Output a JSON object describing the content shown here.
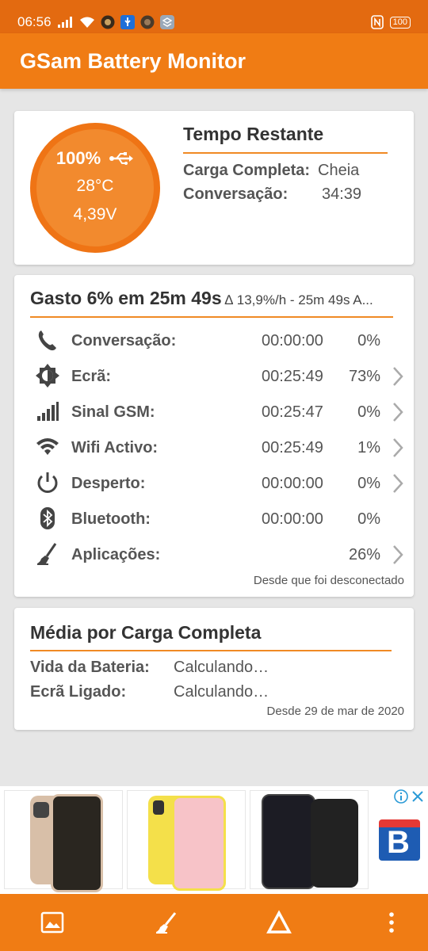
{
  "status_bar": {
    "time": "06:56",
    "battery": "100",
    "icons": [
      "signal-icon",
      "wifi-icon",
      "notification-icon",
      "usb-icon",
      "notification-icon",
      "stack-icon",
      "nfc-icon",
      "battery-icon"
    ]
  },
  "app": {
    "title": "GSam Battery Monitor"
  },
  "gauge": {
    "percent": "100%",
    "temperature": "28°C",
    "voltage": "4,39V",
    "charging_icon": "usb-icon"
  },
  "remaining": {
    "title": "Tempo Restante",
    "rows": [
      {
        "label": "Carga Completa:",
        "value": "Cheia"
      },
      {
        "label": "Conversação:",
        "value": "34:39"
      }
    ]
  },
  "usage": {
    "title": "Gasto 6% em 25m 49s",
    "subtitle": "∆ 13,9%/h - 25m 49s A...",
    "rows": [
      {
        "icon": "phone-icon",
        "label": "Conversação:",
        "time": "00:00:00",
        "percent": "0%",
        "has_details": false
      },
      {
        "icon": "brightness-icon",
        "label": "Ecrã:",
        "time": "00:25:49",
        "percent": "73%",
        "has_details": true
      },
      {
        "icon": "signal-bars-icon",
        "label": "Sinal GSM:",
        "time": "00:25:47",
        "percent": "0%",
        "has_details": true
      },
      {
        "icon": "wifi-icon",
        "label": "Wifi Activo:",
        "time": "00:25:49",
        "percent": "1%",
        "has_details": true
      },
      {
        "icon": "power-icon",
        "label": "Desperto:",
        "time": "00:00:00",
        "percent": "0%",
        "has_details": true
      },
      {
        "icon": "bluetooth-icon",
        "label": "Bluetooth:",
        "time": "00:00:00",
        "percent": "0%",
        "has_details": false
      },
      {
        "icon": "broom-icon",
        "label": "Aplicações:",
        "time": "",
        "percent": "26%",
        "has_details": true
      }
    ],
    "footnote": "Desde que foi desconectado"
  },
  "average": {
    "title": "Média por Carga Completa",
    "rows": [
      {
        "label": "Vida da Bateria:",
        "value": "Calculando…"
      },
      {
        "label": "Ecrã Ligado:",
        "value": "Calculando…"
      }
    ],
    "footnote": "Desde 29 de mar de 2020"
  },
  "ad": {
    "brand_letter": "B",
    "icons": [
      "info-icon",
      "close-icon"
    ]
  },
  "bottom_bar": {
    "icons": [
      "image-icon",
      "broom-icon",
      "delta-icon",
      "more-vert-icon"
    ]
  },
  "colors": {
    "accent": "#f07c14",
    "status_bar": "#e36a10",
    "gauge_fill": "#f28a2e",
    "underline": "#f08a24"
  }
}
